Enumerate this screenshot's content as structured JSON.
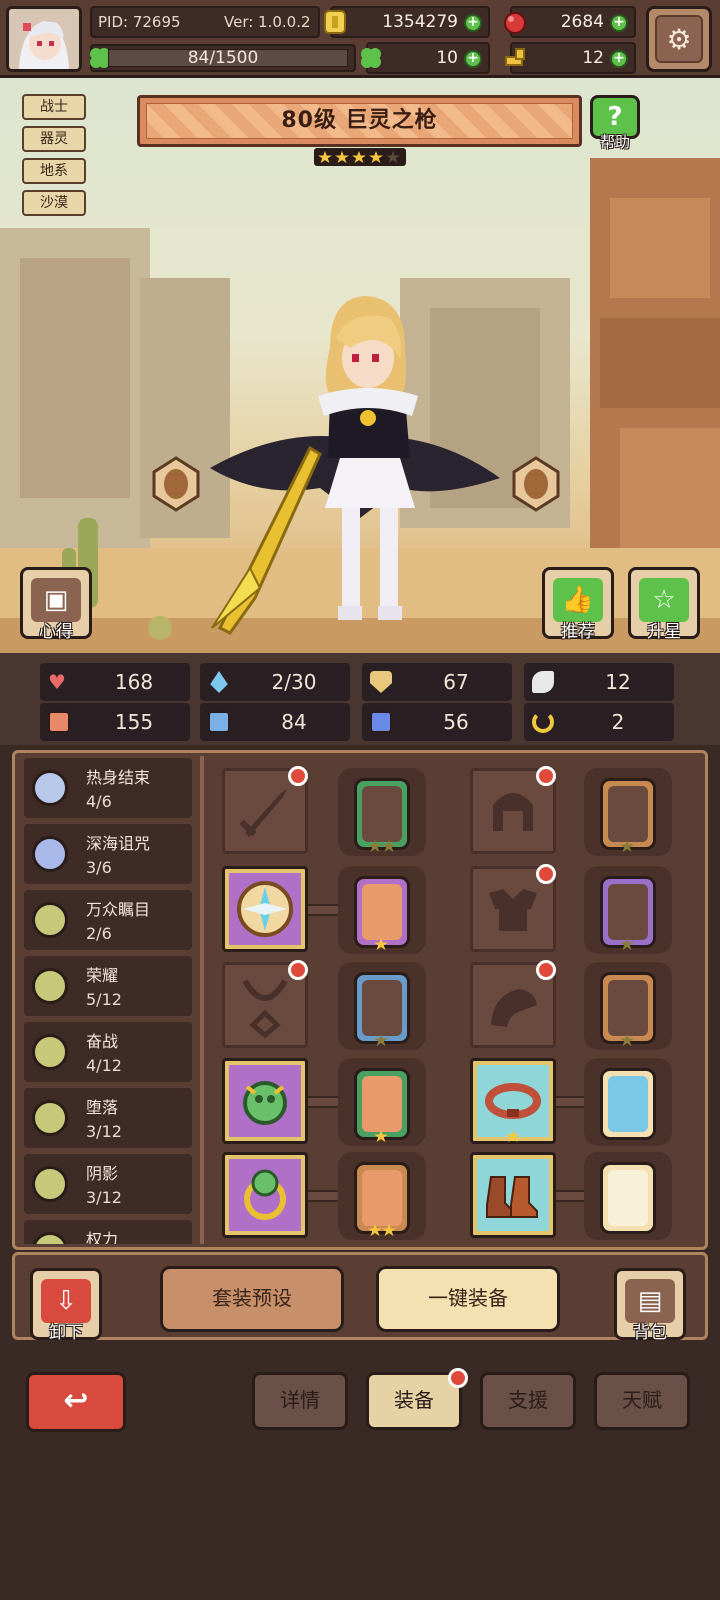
{
  "header": {
    "pid": "PID: 72695",
    "version": "Ver: 1.0.0.2",
    "exp": "84/1500",
    "gold": "1354279",
    "gems": "2684",
    "clover": "10",
    "key": "12"
  },
  "hero": {
    "title": "80级  巨灵之枪",
    "stars_filled": 4,
    "stars_total": 5,
    "tags": [
      "战士",
      "器灵",
      "地系",
      "沙漠"
    ],
    "help_label": "帮助",
    "notes_label": "心得",
    "recommend_label": "推荐",
    "upstar_label": "升星"
  },
  "stats": [
    {
      "icon": "heart-icon",
      "value": "168",
      "color": "#e86a6a"
    },
    {
      "icon": "water-drop-icon",
      "value": "2/30",
      "color": "#7ec8f0"
    },
    {
      "icon": "shield-icon",
      "value": "67",
      "color": "#e8c87a"
    },
    {
      "icon": "wing-icon",
      "value": "12",
      "color": "#e8e8e8"
    },
    {
      "icon": "fist-icon",
      "value": "155",
      "color": "#e88a6a"
    },
    {
      "icon": "book-icon",
      "value": "84",
      "color": "#7ab0e8"
    },
    {
      "icon": "boot-icon",
      "value": "56",
      "color": "#6a8ae8"
    },
    {
      "icon": "horseshoe-icon",
      "value": "2",
      "color": "#f0c840"
    }
  ],
  "sets": [
    {
      "name": "热身结束",
      "count": "4/6",
      "color": "#b8c8e8"
    },
    {
      "name": "深海诅咒",
      "count": "3/6",
      "color": "#a8b8e8"
    },
    {
      "name": "万众瞩目",
      "count": "2/6",
      "color": "#c8c87a"
    },
    {
      "name": "荣耀",
      "count": "5/12",
      "color": "#c8c87a"
    },
    {
      "name": "奋战",
      "count": "4/12",
      "color": "#c8c87a"
    },
    {
      "name": "堕落",
      "count": "3/12",
      "color": "#c8c87a"
    },
    {
      "name": "阴影",
      "count": "3/12",
      "color": "#c8c87a"
    },
    {
      "name": "权力",
      "count": "",
      "color": "#c8c87a"
    }
  ],
  "actions": {
    "unequip": "卸下",
    "preset": "套装预设",
    "one_click": "一键装备",
    "bag": "背包"
  },
  "tabs": [
    "详情",
    "装备",
    "支援",
    "天赋"
  ]
}
